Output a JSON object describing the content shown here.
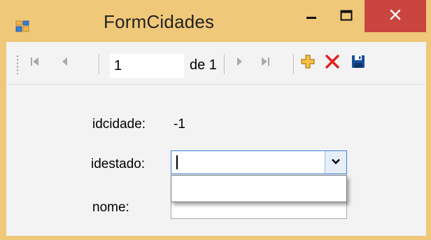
{
  "window": {
    "title": "FormCidades"
  },
  "toolbar": {
    "position_value": "1",
    "count_label": "de 1",
    "icons": [
      "move-first-icon",
      "move-previous-icon",
      "move-next-icon",
      "move-last-icon",
      "add-new-icon",
      "delete-icon",
      "save-icon"
    ]
  },
  "form": {
    "idcidade_label": "idcidade:",
    "idcidade_value": "-1",
    "idestado_label": "idestado:",
    "idestado_value": "",
    "nome_label": "nome:",
    "nome_value": ""
  },
  "colors": {
    "title_bar": "#f0c87a",
    "close_button": "#c9453e",
    "combo_focus_border": "#3b80d8",
    "add_icon": "#f2b533",
    "delete_icon": "#e02020",
    "save_icon": "#1a4f9c"
  }
}
